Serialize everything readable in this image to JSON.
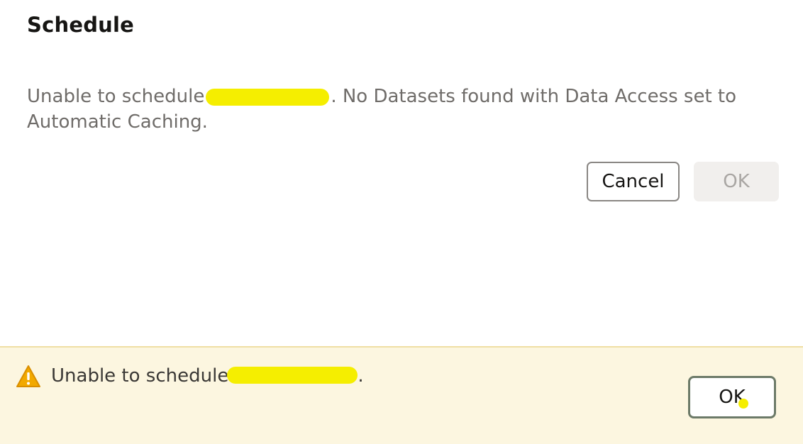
{
  "dialog": {
    "title": "Schedule",
    "message_prefix": "Unable to schedule",
    "message_suffix": ". No Datasets found with Data Access set to Automatic Caching.",
    "cancel_label": "Cancel",
    "ok_label": "OK"
  },
  "notice": {
    "icon": "warning-icon",
    "message_prefix": "Unable to schedule",
    "message_suffix": ".",
    "ok_label": "OK"
  },
  "colors": {
    "notice_background": "#fcf6e0",
    "warning_icon": "#f2a900",
    "redaction_highlight": "#f5ee00"
  }
}
